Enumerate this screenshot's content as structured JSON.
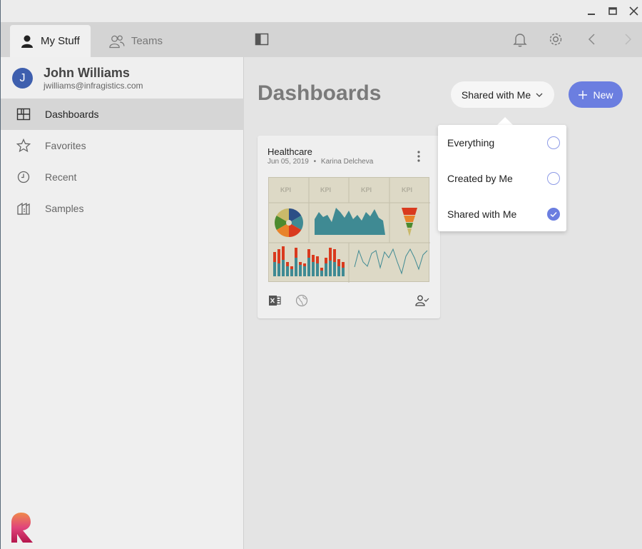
{
  "window": {
    "minimize_icon": "minimize-icon",
    "maximize_icon": "maximize-icon",
    "close_icon": "close-icon"
  },
  "toolbar": {
    "tabs": [
      {
        "label": "My Stuff",
        "icon": "person-icon",
        "active": true
      },
      {
        "label": "Teams",
        "icon": "people-icon",
        "active": false
      }
    ],
    "panel_toggle_icon": "panel-toggle-icon",
    "notifications_icon": "bell-icon",
    "settings_icon": "gear-icon",
    "back_icon": "chevron-left-icon",
    "forward_icon": "chevron-right-icon"
  },
  "user": {
    "initial": "J",
    "name": "John Williams",
    "email": "jwilliams@infragistics.com"
  },
  "sidebar": {
    "items": [
      {
        "label": "Dashboards",
        "icon": "dashboards-icon",
        "selected": true
      },
      {
        "label": "Favorites",
        "icon": "star-icon",
        "selected": false
      },
      {
        "label": "Recent",
        "icon": "clock-icon",
        "selected": false
      },
      {
        "label": "Samples",
        "icon": "samples-icon",
        "selected": false
      }
    ]
  },
  "main": {
    "title": "Dashboards",
    "filter_button": "Shared with Me",
    "new_button": "New"
  },
  "card": {
    "title": "Healthcare",
    "date": "Jun 05, 2019",
    "separator": "•",
    "author": "Karina Delcheva",
    "kpi_label": "KPI"
  },
  "dropdown": {
    "options": [
      {
        "label": "Everything",
        "checked": false
      },
      {
        "label": "Created by Me",
        "checked": false
      },
      {
        "label": "Shared with Me",
        "checked": true
      }
    ]
  },
  "colors": {
    "accent": "#6b7ee0",
    "avatar": "#3e5fae",
    "thumb_teal": "#3f8a93",
    "thumb_red": "#d93a1e",
    "thumb_bg": "#ddd9c6"
  }
}
